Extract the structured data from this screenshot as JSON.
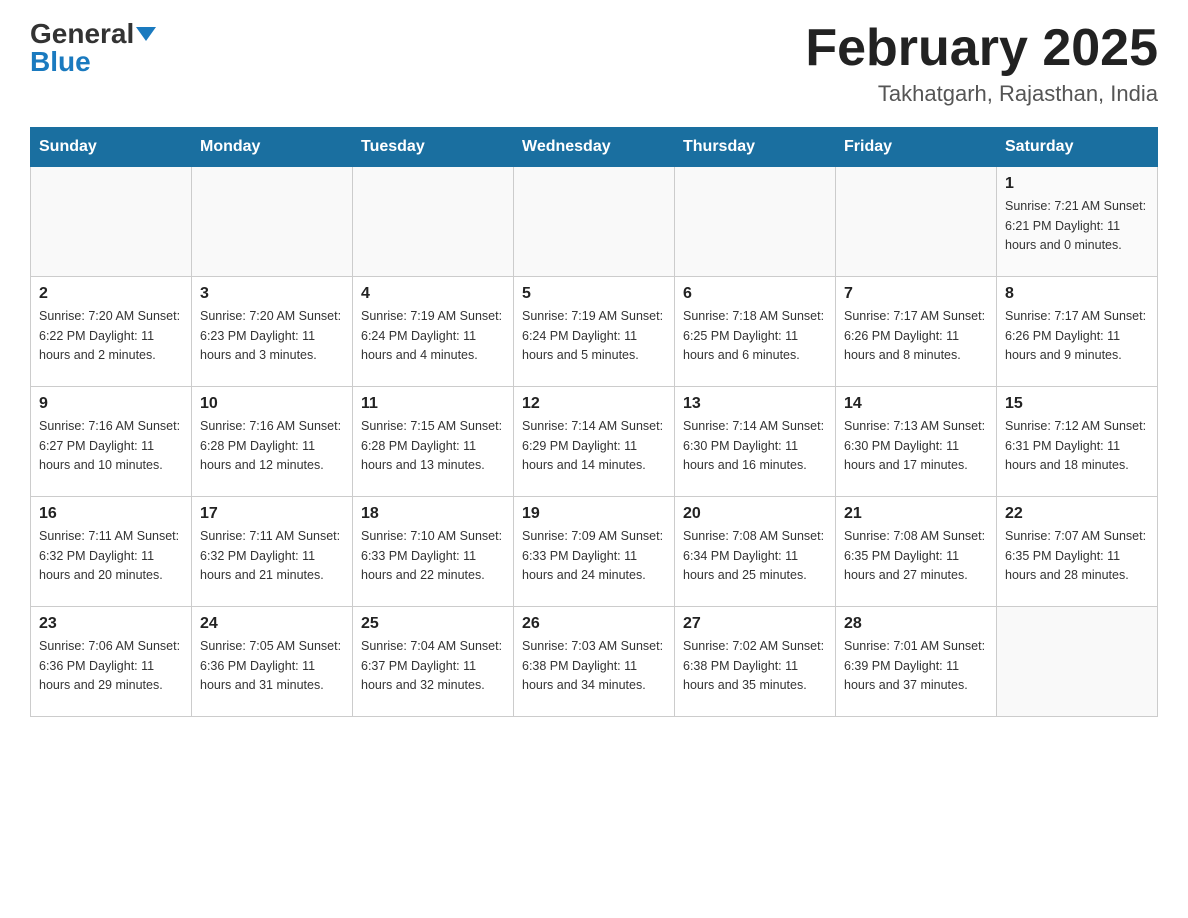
{
  "header": {
    "logo_general": "General",
    "logo_blue": "Blue",
    "title": "February 2025",
    "subtitle": "Takhatgarh, Rajasthan, India"
  },
  "weekdays": [
    "Sunday",
    "Monday",
    "Tuesday",
    "Wednesday",
    "Thursday",
    "Friday",
    "Saturday"
  ],
  "weeks": [
    [
      {
        "day": "",
        "info": ""
      },
      {
        "day": "",
        "info": ""
      },
      {
        "day": "",
        "info": ""
      },
      {
        "day": "",
        "info": ""
      },
      {
        "day": "",
        "info": ""
      },
      {
        "day": "",
        "info": ""
      },
      {
        "day": "1",
        "info": "Sunrise: 7:21 AM\nSunset: 6:21 PM\nDaylight: 11 hours and 0 minutes."
      }
    ],
    [
      {
        "day": "2",
        "info": "Sunrise: 7:20 AM\nSunset: 6:22 PM\nDaylight: 11 hours and 2 minutes."
      },
      {
        "day": "3",
        "info": "Sunrise: 7:20 AM\nSunset: 6:23 PM\nDaylight: 11 hours and 3 minutes."
      },
      {
        "day": "4",
        "info": "Sunrise: 7:19 AM\nSunset: 6:24 PM\nDaylight: 11 hours and 4 minutes."
      },
      {
        "day": "5",
        "info": "Sunrise: 7:19 AM\nSunset: 6:24 PM\nDaylight: 11 hours and 5 minutes."
      },
      {
        "day": "6",
        "info": "Sunrise: 7:18 AM\nSunset: 6:25 PM\nDaylight: 11 hours and 6 minutes."
      },
      {
        "day": "7",
        "info": "Sunrise: 7:17 AM\nSunset: 6:26 PM\nDaylight: 11 hours and 8 minutes."
      },
      {
        "day": "8",
        "info": "Sunrise: 7:17 AM\nSunset: 6:26 PM\nDaylight: 11 hours and 9 minutes."
      }
    ],
    [
      {
        "day": "9",
        "info": "Sunrise: 7:16 AM\nSunset: 6:27 PM\nDaylight: 11 hours and 10 minutes."
      },
      {
        "day": "10",
        "info": "Sunrise: 7:16 AM\nSunset: 6:28 PM\nDaylight: 11 hours and 12 minutes."
      },
      {
        "day": "11",
        "info": "Sunrise: 7:15 AM\nSunset: 6:28 PM\nDaylight: 11 hours and 13 minutes."
      },
      {
        "day": "12",
        "info": "Sunrise: 7:14 AM\nSunset: 6:29 PM\nDaylight: 11 hours and 14 minutes."
      },
      {
        "day": "13",
        "info": "Sunrise: 7:14 AM\nSunset: 6:30 PM\nDaylight: 11 hours and 16 minutes."
      },
      {
        "day": "14",
        "info": "Sunrise: 7:13 AM\nSunset: 6:30 PM\nDaylight: 11 hours and 17 minutes."
      },
      {
        "day": "15",
        "info": "Sunrise: 7:12 AM\nSunset: 6:31 PM\nDaylight: 11 hours and 18 minutes."
      }
    ],
    [
      {
        "day": "16",
        "info": "Sunrise: 7:11 AM\nSunset: 6:32 PM\nDaylight: 11 hours and 20 minutes."
      },
      {
        "day": "17",
        "info": "Sunrise: 7:11 AM\nSunset: 6:32 PM\nDaylight: 11 hours and 21 minutes."
      },
      {
        "day": "18",
        "info": "Sunrise: 7:10 AM\nSunset: 6:33 PM\nDaylight: 11 hours and 22 minutes."
      },
      {
        "day": "19",
        "info": "Sunrise: 7:09 AM\nSunset: 6:33 PM\nDaylight: 11 hours and 24 minutes."
      },
      {
        "day": "20",
        "info": "Sunrise: 7:08 AM\nSunset: 6:34 PM\nDaylight: 11 hours and 25 minutes."
      },
      {
        "day": "21",
        "info": "Sunrise: 7:08 AM\nSunset: 6:35 PM\nDaylight: 11 hours and 27 minutes."
      },
      {
        "day": "22",
        "info": "Sunrise: 7:07 AM\nSunset: 6:35 PM\nDaylight: 11 hours and 28 minutes."
      }
    ],
    [
      {
        "day": "23",
        "info": "Sunrise: 7:06 AM\nSunset: 6:36 PM\nDaylight: 11 hours and 29 minutes."
      },
      {
        "day": "24",
        "info": "Sunrise: 7:05 AM\nSunset: 6:36 PM\nDaylight: 11 hours and 31 minutes."
      },
      {
        "day": "25",
        "info": "Sunrise: 7:04 AM\nSunset: 6:37 PM\nDaylight: 11 hours and 32 minutes."
      },
      {
        "day": "26",
        "info": "Sunrise: 7:03 AM\nSunset: 6:38 PM\nDaylight: 11 hours and 34 minutes."
      },
      {
        "day": "27",
        "info": "Sunrise: 7:02 AM\nSunset: 6:38 PM\nDaylight: 11 hours and 35 minutes."
      },
      {
        "day": "28",
        "info": "Sunrise: 7:01 AM\nSunset: 6:39 PM\nDaylight: 11 hours and 37 minutes."
      },
      {
        "day": "",
        "info": ""
      }
    ]
  ]
}
